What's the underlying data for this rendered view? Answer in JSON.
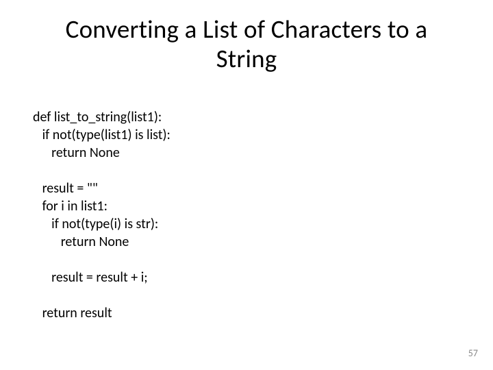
{
  "title": "Converting a List of Characters to a String",
  "code": {
    "l1": "def list_to_string(list1):",
    "l2": "   if not(type(list1) is list):",
    "l3": "      return None",
    "l4": "",
    "l5": "   result = \"\"",
    "l6": "   for i in list1:",
    "l7": "      if not(type(i) is str):",
    "l8": "         return None",
    "l9": "",
    "l10": "      result = result + i;",
    "l11": "",
    "l12": "   return result"
  },
  "page_number": "57"
}
